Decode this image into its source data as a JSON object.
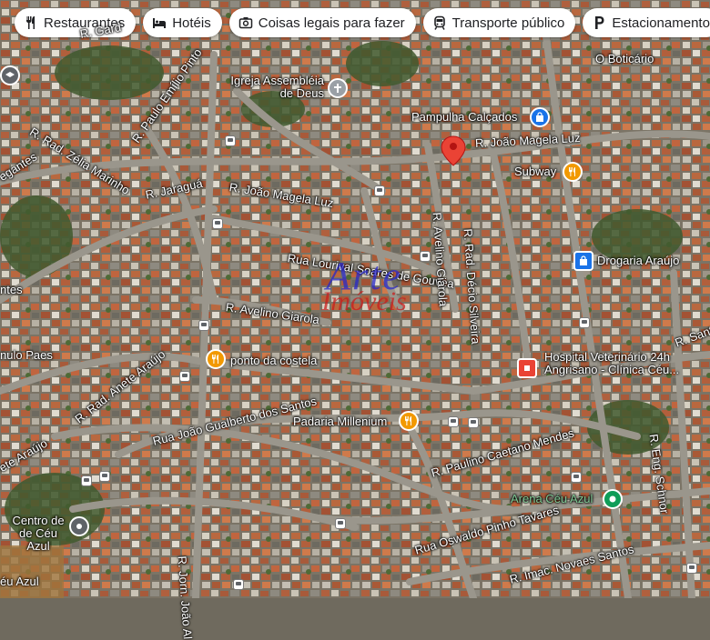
{
  "filters": [
    {
      "label": "Restaurantes",
      "icon": "fork-knife-icon"
    },
    {
      "label": "Hotéis",
      "icon": "bed-icon"
    },
    {
      "label": "Coisas legais para fazer",
      "icon": "camera-icon"
    },
    {
      "label": "Transporte público",
      "icon": "train-icon"
    },
    {
      "label": "Estacionamento",
      "icon": "parking-icon"
    }
  ],
  "streets": {
    "s1": "R. Paulo Emílio Pinto",
    "s2": "R. Rad. Zélia Marinho",
    "s3": "R. Jaraguá",
    "s4": "R. João Magela Luz",
    "s5": "R. João Magela Luz",
    "s6": "Rua Lourival Soares de Gouvea",
    "s7": "R. Avelino Giarola",
    "s8": "R. Avelino Giarola",
    "s9": "R. Rad. Décio Silveira",
    "s10": "R. Rad. Anete Araújo",
    "s11": "Rua João Gualberto dos Santos",
    "s12": "R. Paulino Caetano Mendes",
    "s13": "Rua Oswaldo Pinho Tavares",
    "s14": "R. Imac. Novaes Santos",
    "s15": "R. Jorn. João Al",
    "s16": "R. Eng. Schnor",
    "s17": "R. Sant",
    "s18": "egantes",
    "s19": "ntes",
    "s20": "nulo Paes",
    "s21": "ete Araújo",
    "s22": "R. Gard",
    "s23": "éu Azul"
  },
  "places": {
    "igreja": "Igreja Assembléia de Deus",
    "pampulha": "Pampulha Calçados",
    "boticario": "O Boticário",
    "subway": "Subway",
    "drogaria": "Drogaria Araújo",
    "hospital": "Hospital Veterinário 24h Angrisano - Clínica Céu...",
    "costela": "ponto da costela",
    "padaria": "Padaria Millenium",
    "arena": "Arena Céu Azul",
    "centro": "Centro de de Céu Azul"
  },
  "watermark": {
    "line1": "Arte",
    "line2": "Imóveis"
  },
  "colors": {
    "restaurant": "#f29900",
    "shopping": "#1a73e8",
    "medical": "#ea4335",
    "sports": "#0f9d58",
    "pin": "#ea4335"
  }
}
